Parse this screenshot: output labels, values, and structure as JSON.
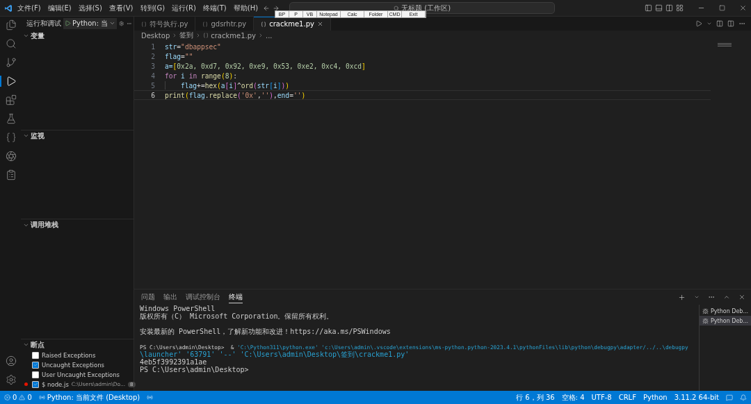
{
  "menu": [
    "文件(F)",
    "编辑(E)",
    "选择(S)",
    "查看(V)",
    "转到(G)",
    "运行(R)",
    "终端(T)",
    "帮助(H)"
  ],
  "title_search": "无标题 (工作区)",
  "quick_toolbar": [
    "BP",
    "P",
    "VB",
    "Notepad",
    "Calc",
    "Folder",
    "CMD",
    "Exit"
  ],
  "sidebar": {
    "title": "运行和调试",
    "config": "Python: 当",
    "sections": [
      {
        "title": "变量",
        "expanded": true
      },
      {
        "title": "监视",
        "expanded": true
      },
      {
        "title": "调用堆栈",
        "expanded": true
      },
      {
        "title": "断点",
        "expanded": true
      }
    ],
    "breakpoints": [
      {
        "label": "Raised Exceptions",
        "checked": false
      },
      {
        "label": "Uncaught Exceptions",
        "checked": true
      },
      {
        "label": "User Uncaught Exceptions",
        "checked": false
      },
      {
        "label": "$ node.js",
        "path": "C:\\Users\\admin\\Do...",
        "count": "8",
        "checked": true
      }
    ]
  },
  "tabs": [
    {
      "label": "符号执行.py",
      "selected": false
    },
    {
      "label": "gdsrhtr.py",
      "selected": false
    },
    {
      "label": "crackme1.py",
      "selected": true
    }
  ],
  "breadcrumbs": [
    "Desktop",
    "签到",
    "crackme1.py",
    "..."
  ],
  "code": [
    {
      "number": "1",
      "current": false,
      "indent": false,
      "tokens": [
        {
          "text": "str",
          "kind": "var"
        },
        {
          "text": "=",
          "kind": "op"
        },
        {
          "text": "\"dbappsec\"",
          "kind": "str"
        }
      ]
    },
    {
      "number": "2",
      "current": false,
      "indent": false,
      "tokens": [
        {
          "text": "flag",
          "kind": "var"
        },
        {
          "text": "=",
          "kind": "op"
        },
        {
          "text": "\"\"",
          "kind": "str"
        }
      ]
    },
    {
      "number": "3",
      "current": false,
      "indent": false,
      "tokens": [
        {
          "text": "a=",
          "kind": "var"
        },
        {
          "text": "[",
          "kind": "br1"
        },
        {
          "text": "0x2a, 0xd7, 0x92, 0xe9, 0x53, 0xe2, 0xc4, 0xcd",
          "kind": "num"
        },
        {
          "text": "]",
          "kind": "br1"
        }
      ]
    },
    {
      "number": "4",
      "current": false,
      "indent": false,
      "tokens": [
        {
          "text": "for",
          "kind": "kw"
        },
        {
          "text": " i ",
          "kind": "var"
        },
        {
          "text": "in",
          "kind": "kw"
        },
        {
          "text": " range",
          "kind": "fn"
        },
        {
          "text": "(",
          "kind": "br1"
        },
        {
          "text": "8",
          "kind": "num"
        },
        {
          "text": ")",
          "kind": "br1"
        },
        {
          "text": ":",
          "kind": "op"
        }
      ]
    },
    {
      "number": "5",
      "current": false,
      "indent": true,
      "tokens": [
        {
          "text": "flag",
          "kind": "var"
        },
        {
          "text": "+=",
          "kind": "op"
        },
        {
          "text": "hex",
          "kind": "fn"
        },
        {
          "text": "(",
          "kind": "br1"
        },
        {
          "text": "a",
          "kind": "var"
        },
        {
          "text": "[",
          "kind": "br2"
        },
        {
          "text": "i",
          "kind": "var"
        },
        {
          "text": "]",
          "kind": "br2"
        },
        {
          "text": "^",
          "kind": "op"
        },
        {
          "text": "ord",
          "kind": "fn"
        },
        {
          "text": "(",
          "kind": "br2"
        },
        {
          "text": "str",
          "kind": "var"
        },
        {
          "text": "[",
          "kind": "br3"
        },
        {
          "text": "i",
          "kind": "var"
        },
        {
          "text": "]",
          "kind": "br3"
        },
        {
          "text": ")",
          "kind": "br2"
        },
        {
          "text": ")",
          "kind": "br1"
        }
      ]
    },
    {
      "number": "6",
      "current": true,
      "indent": false,
      "tokens": [
        {
          "text": "print",
          "kind": "fn"
        },
        {
          "text": "(",
          "kind": "br1"
        },
        {
          "text": "flag",
          "kind": "var"
        },
        {
          "text": ".",
          "kind": "op"
        },
        {
          "text": "replace",
          "kind": "fn"
        },
        {
          "text": "(",
          "kind": "br2"
        },
        {
          "text": "'0x'",
          "kind": "str"
        },
        {
          "text": ",",
          "kind": "op"
        },
        {
          "text": "''",
          "kind": "str"
        },
        {
          "text": ")",
          "kind": "br2"
        },
        {
          "text": ",",
          "kind": "op"
        },
        {
          "text": "end",
          "kind": "var"
        },
        {
          "text": "=",
          "kind": "op"
        },
        {
          "text": "''",
          "kind": "str"
        },
        {
          "text": ")",
          "kind": "br1"
        }
      ]
    }
  ],
  "panel": {
    "tabs": [
      {
        "label": "问题",
        "selected": false
      },
      {
        "label": "输出",
        "selected": false
      },
      {
        "label": "调试控制台",
        "selected": false
      },
      {
        "label": "终端",
        "selected": true
      }
    ],
    "lines": [
      {
        "kind": "output",
        "segments": [
          {
            "text": "Windows PowerShell",
            "kind": "text"
          }
        ]
      },
      {
        "kind": "output",
        "segments": [
          {
            "text": "版权所有（C） Microsoft Corporation。保留所有权利。",
            "kind": "text"
          }
        ]
      },
      {
        "kind": "blank"
      },
      {
        "kind": "output",
        "segments": [
          {
            "text": "安装最新的 PowerShell，了解新功能和改进！https://aka.ms/PSWindows",
            "kind": "text"
          }
        ]
      },
      {
        "kind": "blank"
      },
      {
        "kind": "output",
        "segments": [
          {
            "text": "PS C:\\Users\\admin\\Desktop>  & ",
            "kind": "text"
          },
          {
            "text": "'C:\\Python311\\python.exe' 'c:\\Users\\admin\\.vscode\\extensions\\ms-python.python-2023.4.1\\pythonFiles\\lib\\python\\debugpy\\adapter/../..\\debugpy",
            "kind": "arg"
          }
        ]
      },
      {
        "kind": "output",
        "segments": [
          {
            "text": "\\launcher' '63791' '--' 'C:\\Users\\admin\\Desktop\\签到\\crackme1.py'",
            "kind": "arg"
          }
        ]
      },
      {
        "kind": "output",
        "segments": [
          {
            "text": "4eb5f3992391a1ae",
            "kind": "text"
          }
        ]
      },
      {
        "kind": "output",
        "segments": [
          {
            "text": "PS C:\\Users\\admin\\Desktop>",
            "kind": "text"
          }
        ]
      }
    ],
    "terminals": [
      {
        "label": "Python Deb...",
        "selected": false
      },
      {
        "label": "Python Deb...",
        "selected": true
      }
    ]
  },
  "status": {
    "errors": "0",
    "warnings": "0",
    "config": "Python: 当前文件 (Desktop)",
    "right": [
      "行 6，列 36",
      "空格: 4",
      "UTF-8",
      "CRLF",
      "Python",
      "3.11.2 64-bit"
    ]
  }
}
